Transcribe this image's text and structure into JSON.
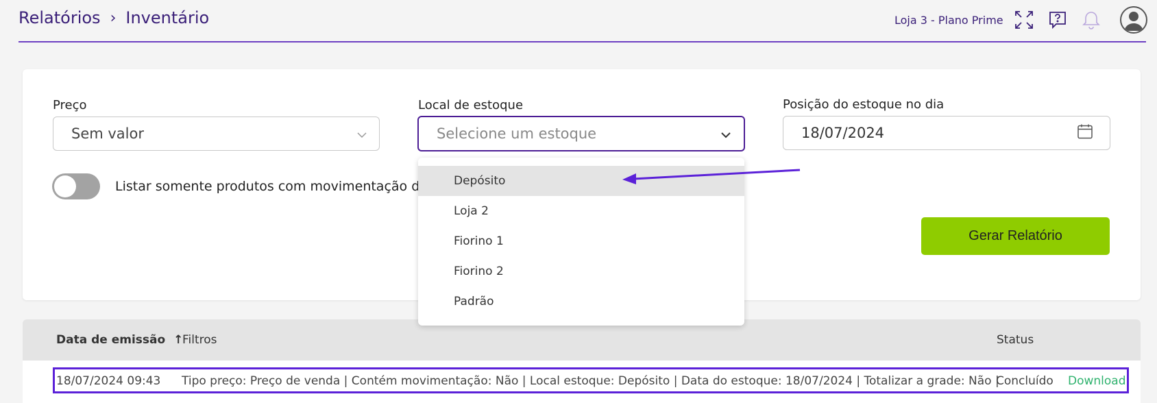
{
  "header": {
    "breadcrumb": [
      "Relatórios",
      "Inventário"
    ],
    "separator": "›",
    "store_label": "Loja 3 - Plano Prime",
    "icons": [
      "fullscreen-icon",
      "help-icon",
      "bell-icon",
      "user-avatar-icon"
    ]
  },
  "filters": {
    "price": {
      "label": "Preço",
      "value": "Sem valor"
    },
    "stock_location": {
      "label": "Local de estoque",
      "placeholder": "Selecione um estoque"
    },
    "stock_date": {
      "label": "Posição do estoque no dia",
      "value": "18/07/2024"
    },
    "toggle": {
      "label": "Listar somente produtos com movimentação de estoque",
      "checked": false
    },
    "generate_button": "Gerar Relatório"
  },
  "dropdown": {
    "options": [
      "Depósito",
      "Loja 2",
      "Fiorino 1",
      "Fiorino 2",
      "Padrão"
    ],
    "highlighted": "Depósito"
  },
  "table": {
    "headers": {
      "date": "Data de emissão",
      "sort_indicator": "↑",
      "filters": "Filtros",
      "status": "Status"
    },
    "rows": [
      {
        "date": "18/07/2024 09:43",
        "filters": "Tipo preço: Preço de venda | Contém movimentação: Não | Local estoque: Depósito | Data do estoque: 18/07/2024 | Totalizar a grade: Não |",
        "status": "Concluído",
        "action": "Download"
      }
    ]
  },
  "colors": {
    "accent": "#4c1d95",
    "primary_button": "#8fcc00",
    "download_link": "#2fb26e",
    "annotation": "#5b21d8"
  }
}
